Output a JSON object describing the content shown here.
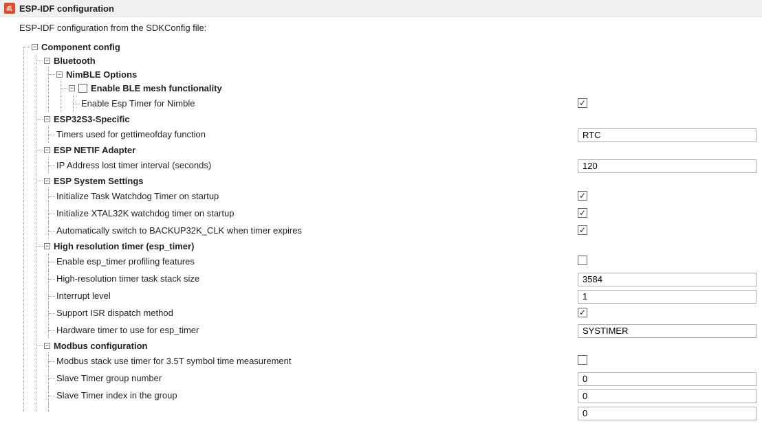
{
  "header": {
    "title": "ESP-IDF configuration"
  },
  "subtitle": "ESP-IDF configuration from the SDKConfig file:",
  "tree": {
    "root": "Component config",
    "bluetooth": {
      "label": "Bluetooth",
      "nimble": {
        "label": "NimBLE Options",
        "ble_mesh": {
          "label": "Enable BLE mesh functionality",
          "children": {
            "esp_timer_nimble": {
              "label": "Enable Esp Timer for Nimble",
              "checked": true
            }
          }
        }
      }
    },
    "esp32s3": {
      "label": "ESP32S3-Specific",
      "children": {
        "timers_gettimeofday": {
          "label": "Timers used for gettimeofday function",
          "value": "RTC"
        }
      }
    },
    "esp_netif": {
      "label": "ESP NETIF Adapter",
      "children": {
        "ip_lost_timer": {
          "label": "IP Address lost timer interval (seconds)",
          "value": "120"
        }
      }
    },
    "esp_system": {
      "label": "ESP System Settings",
      "children": {
        "init_twdt": {
          "label": "Initialize Task Watchdog Timer on startup",
          "checked": true
        },
        "init_xtal32k": {
          "label": "Initialize XTAL32K watchdog timer on startup",
          "checked": true
        },
        "auto_backup32k": {
          "label": "Automatically switch to BACKUP32K_CLK when timer expires",
          "checked": true
        }
      }
    },
    "hires_timer": {
      "label": "High resolution timer (esp_timer)",
      "children": {
        "profiling": {
          "label": "Enable esp_timer profiling features",
          "checked": false
        },
        "stack_size": {
          "label": "High-resolution timer task stack size",
          "value": "3584"
        },
        "int_level": {
          "label": "Interrupt level",
          "value": "1"
        },
        "isr_dispatch": {
          "label": "Support ISR dispatch method",
          "checked": true
        },
        "hw_timer": {
          "label": "Hardware timer to use for esp_timer",
          "value": "SYSTIMER"
        }
      }
    },
    "modbus": {
      "label": "Modbus configuration",
      "children": {
        "use_timer_35t": {
          "label": "Modbus stack use timer for 3.5T symbol time measurement",
          "checked": false
        },
        "slave_timer_group": {
          "label": "Slave Timer group number",
          "value": "0"
        },
        "slave_timer_index": {
          "label": "Slave Timer index in the group",
          "value": "0"
        }
      }
    }
  },
  "value_column_left": 840
}
